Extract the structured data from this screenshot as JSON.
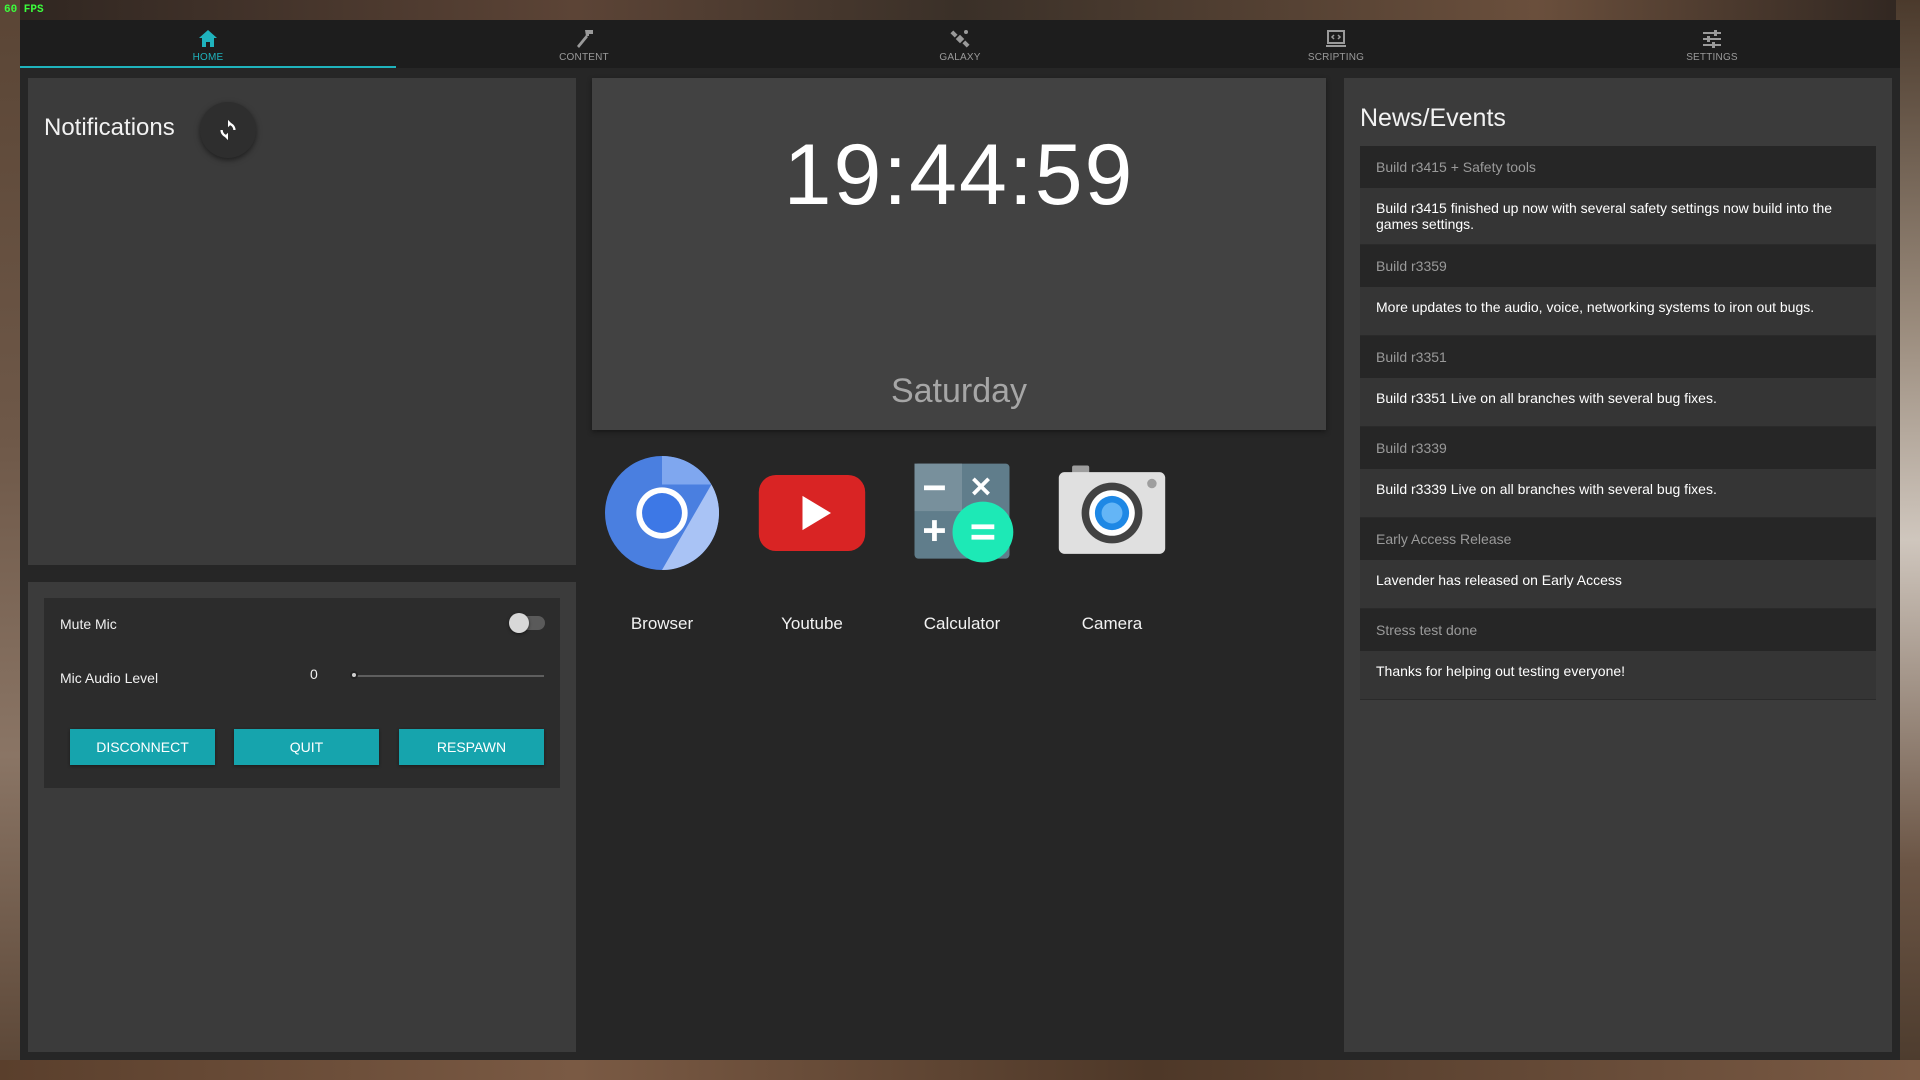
{
  "fps": "60 FPS",
  "nav": {
    "tabs": [
      {
        "label": "HOME",
        "icon": "home-icon",
        "active": true
      },
      {
        "label": "CONTENT",
        "icon": "hammer-icon"
      },
      {
        "label": "GALAXY",
        "icon": "satellite-icon"
      },
      {
        "label": "SCRIPTING",
        "icon": "code-screen-icon"
      },
      {
        "label": "SETTINGS",
        "icon": "sliders-icon"
      }
    ],
    "accent": "#1fb3bd"
  },
  "notifications": {
    "title": "Notifications",
    "refresh_icon": "refresh-icon"
  },
  "controls": {
    "mute_label": "Mute Mic",
    "mute_on": false,
    "level_label": "Mic Audio Level",
    "level_value": "0",
    "buttons": {
      "disconnect": "DISCONNECT",
      "quit": "QUIT",
      "respawn": "RESPAWN"
    },
    "button_color": "#16a4ad"
  },
  "clock": {
    "time": "19:44:59",
    "day": "Saturday"
  },
  "apps": [
    {
      "name": "Browser",
      "icon": "chromium-icon"
    },
    {
      "name": "Youtube",
      "icon": "youtube-icon"
    },
    {
      "name": "Calculator",
      "icon": "calculator-icon"
    },
    {
      "name": "Camera",
      "icon": "camera-icon"
    }
  ],
  "news": {
    "title": "News/Events",
    "items": [
      {
        "title": "Build r3415 + Safety tools",
        "body": "Build r3415 finished up now with several safety settings now build into the games settings."
      },
      {
        "title": "Build r3359",
        "body": "More updates to the audio, voice, networking systems to iron out bugs."
      },
      {
        "title": "Build r3351",
        "body": "Build r3351 Live on all branches with several bug fixes."
      },
      {
        "title": "Build r3339",
        "body": "Build r3339 Live on all branches with several bug fixes."
      },
      {
        "title": "Early Access Release",
        "body": "Lavender has released on Early Access"
      },
      {
        "title": "Stress test done",
        "body": "Thanks for helping out testing everyone!"
      }
    ]
  }
}
